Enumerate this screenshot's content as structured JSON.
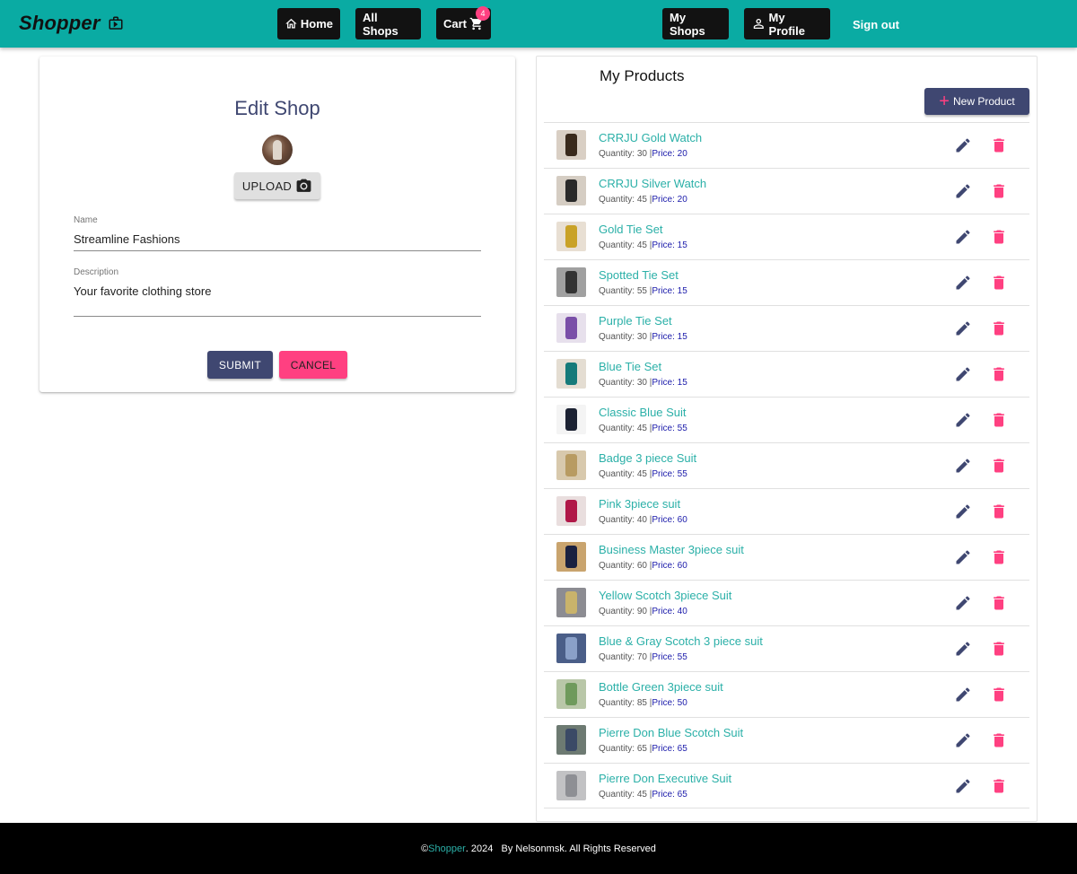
{
  "header": {
    "brand": "Shopper",
    "nav": {
      "home": "Home",
      "all_shops": "All Shops",
      "cart": "Cart",
      "cart_count": "4",
      "my_shops": "My Shops",
      "my_profile": "My Profile",
      "sign_out": "Sign out"
    }
  },
  "edit_shop": {
    "title": "Edit Shop",
    "upload_label": "UPLOAD",
    "name_label": "Name",
    "name_value": "Streamline Fashions",
    "description_label": "Description",
    "description_value": "Your favorite clothing store",
    "submit_label": "SUBMIT",
    "cancel_label": "CANCEL"
  },
  "products": {
    "title": "My Products",
    "new_product_label": "New Product",
    "quantity_prefix": "Quantity: ",
    "price_prefix": "Price: ",
    "items": [
      {
        "name": "CRRJU Gold Watch",
        "quantity": "30",
        "price": "20",
        "thumb_bg": "#d9cfc4",
        "thumb_fg": "#3a2a1c"
      },
      {
        "name": "CRRJU Silver Watch",
        "quantity": "45",
        "price": "20",
        "thumb_bg": "#d5cdc3",
        "thumb_fg": "#2a2a2a"
      },
      {
        "name": "Gold Tie Set",
        "quantity": "45",
        "price": "15",
        "thumb_bg": "#e8dfd3",
        "thumb_fg": "#c9a227"
      },
      {
        "name": "Spotted Tie Set",
        "quantity": "55",
        "price": "15",
        "thumb_bg": "#a0a0a0",
        "thumb_fg": "#333333"
      },
      {
        "name": "Purple Tie Set",
        "quantity": "30",
        "price": "15",
        "thumb_bg": "#e7e0ec",
        "thumb_fg": "#7a4fa8"
      },
      {
        "name": "Blue Tie Set",
        "quantity": "30",
        "price": "15",
        "thumb_bg": "#e4ddd2",
        "thumb_fg": "#157a7a"
      },
      {
        "name": "Classic Blue Suit",
        "quantity": "45",
        "price": "55",
        "thumb_bg": "#f4f4f4",
        "thumb_fg": "#1c2233"
      },
      {
        "name": "Badge 3 piece Suit",
        "quantity": "45",
        "price": "55",
        "thumb_bg": "#d8c9ad",
        "thumb_fg": "#b89b62"
      },
      {
        "name": "Pink 3piece suit",
        "quantity": "40",
        "price": "60",
        "thumb_bg": "#e9dede",
        "thumb_fg": "#b01848"
      },
      {
        "name": "Business Master 3piece suit",
        "quantity": "60",
        "price": "60",
        "thumb_bg": "#c9a46e",
        "thumb_fg": "#1a2140"
      },
      {
        "name": "Yellow Scotch 3piece Suit",
        "quantity": "90",
        "price": "40",
        "thumb_bg": "#8c8c92",
        "thumb_fg": "#c9b36b"
      },
      {
        "name": "Blue & Gray Scotch 3 piece suit",
        "quantity": "70",
        "price": "55",
        "thumb_bg": "#4a5e88",
        "thumb_fg": "#8aa0c8"
      },
      {
        "name": "Bottle Green 3piece suit",
        "quantity": "85",
        "price": "50",
        "thumb_bg": "#b9c7a8",
        "thumb_fg": "#6f9a5c"
      },
      {
        "name": "Pierre Don Blue Scotch Suit",
        "quantity": "65",
        "price": "65",
        "thumb_bg": "#6d7a72",
        "thumb_fg": "#3b4a66"
      },
      {
        "name": "Pierre Don Executive Suit",
        "quantity": "45",
        "price": "65",
        "thumb_bg": "#c2c2c4",
        "thumb_fg": "#8e8f94"
      }
    ]
  },
  "footer": {
    "prefix": "© ",
    "brand": "Shopper",
    "suffix": ". 2024   By Nelsonmsk. All Rights Reserved"
  },
  "colors": {
    "topbar": "#0aaba3",
    "primary": "#3f4771",
    "accent": "#ff4081",
    "link": "#2bb0a8"
  }
}
